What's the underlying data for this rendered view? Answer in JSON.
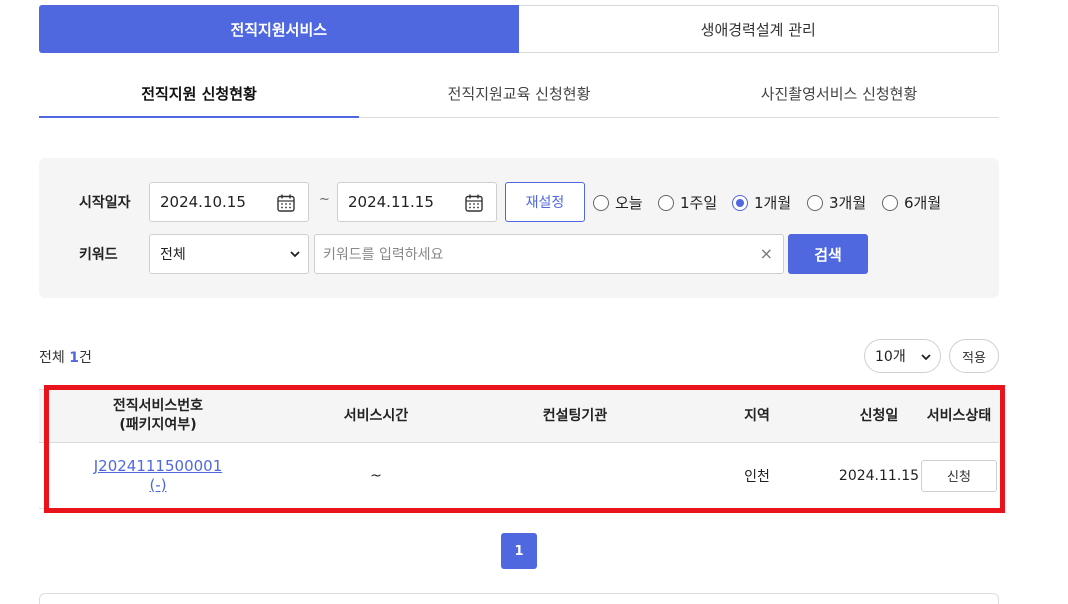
{
  "service_tabs": [
    {
      "label": "전직지원서비스",
      "active": true
    },
    {
      "label": "생애경력설계 관리",
      "active": false
    }
  ],
  "sub_tabs": [
    {
      "label": "전직지원 신청현황",
      "active": true
    },
    {
      "label": "전직지원교육 신청현황",
      "active": false
    },
    {
      "label": "사진촬영서비스 신청현황",
      "active": false
    }
  ],
  "search": {
    "start_label": "시작일자",
    "start_date": "2024.10.15",
    "tilde": "~",
    "end_date": "2024.11.15",
    "reset_label": "재설정",
    "periods": [
      {
        "label": "오늘",
        "checked": false
      },
      {
        "label": "1주일",
        "checked": false
      },
      {
        "label": "1개월",
        "checked": true
      },
      {
        "label": "3개월",
        "checked": false
      },
      {
        "label": "6개월",
        "checked": false
      }
    ],
    "keyword_label": "키워드",
    "keyword_scope": "전체",
    "keyword_placeholder": "키워드를 입력하세요",
    "clear_symbol": "×",
    "search_label": "검색"
  },
  "summary": {
    "total_prefix": "전체",
    "total_count": "1",
    "total_suffix": "건",
    "page_size": "10개",
    "apply_label": "적용"
  },
  "table": {
    "headers": [
      "전직서비스번호",
      "(패키지여부)",
      "서비스시간",
      "컨설팅기관",
      "지역",
      "신청일",
      "서비스상태"
    ],
    "rows": [
      {
        "service_no": "J2024111500001",
        "package": "(-)",
        "service_time": "~",
        "agency": "",
        "region": "인천",
        "applied_date": "2024.11.15",
        "status": "신청"
      }
    ]
  },
  "pagination": {
    "current": "1"
  },
  "colors": {
    "accent": "#4f68e0",
    "highlight": "#e8131b",
    "panel": "#f5f5f5"
  }
}
